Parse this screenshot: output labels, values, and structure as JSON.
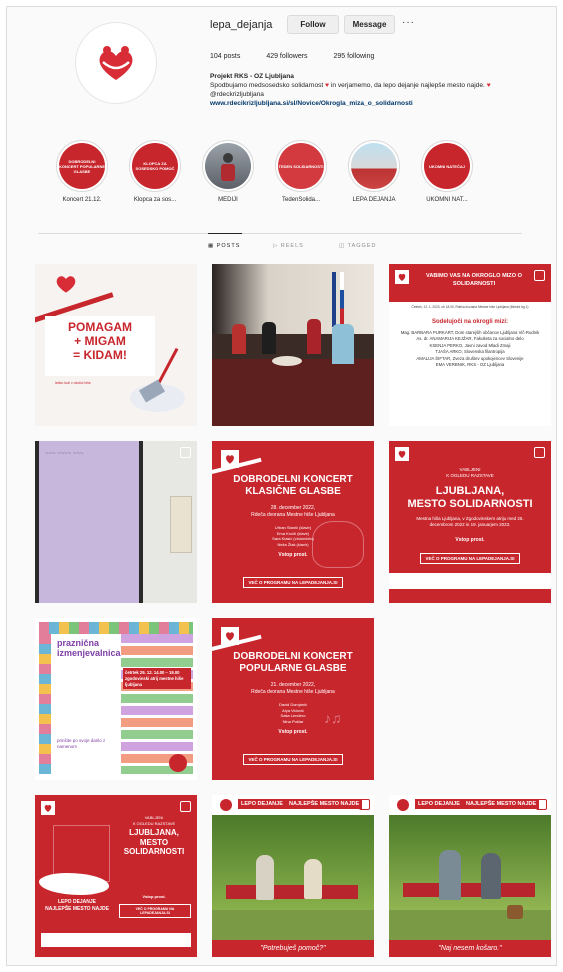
{
  "profile": {
    "username": "lepa_dejanja",
    "follow_label": "Follow",
    "message_label": "Message",
    "more_label": "···",
    "stats": {
      "posts": "104 posts",
      "followers": "429 followers",
      "following": "295 following"
    },
    "bio_name": "Projekt RKS - OZ Ljubljana",
    "bio_line1": "Spodbujamo medsosedsko solidarnost",
    "bio_line1b": "in verjamemo, da lepo dejanje najlepše mesto",
    "bio_line2a": "najde.",
    "bio_line2b": "@rdeckrizljubljana",
    "bio_link": "www.rdecikrizljubljana.si/sl/Novice/Okrogla_miza_o_solidarnosti"
  },
  "highlights": [
    {
      "label": "Koncert 21.12.",
      "inner": "DOBRODELNI KONCERT POPULARNE GLASBE",
      "color": "#c8262d"
    },
    {
      "label": "Klopca za sos...",
      "inner": "KLOPCA ZA SOSEDSKO POMOČ",
      "color": "#c8262d"
    },
    {
      "label": "MEDIJI",
      "inner": "",
      "color": "#7a7f86"
    },
    {
      "label": "TedenSolida...",
      "inner": "TEDEN SOLIDARNOSTI",
      "color": "#d23a40"
    },
    {
      "label": "LEPA DEJANJA",
      "inner": "",
      "color": "#cfd6dc"
    },
    {
      "label": "UKOMNI NAT...",
      "inner": "UKOMNI NATEČAJ",
      "color": "#c8262d"
    }
  ],
  "tabs": {
    "posts": "POSTS",
    "reels": "REELS",
    "tagged": "TAGGED"
  },
  "posts": {
    "p1": {
      "line1": "POMAGAM",
      "line2": "+ MIGAM",
      "line3": "= KIDAM!",
      "small": "lahko tudi v okolici hiše"
    },
    "p3": {
      "title": "VABIMO VAS NA OKROGLO MIZO O SOLIDARNOSTI",
      "date": "Četrtek, 12. 1. 2023, ob 18.00, Rdeča dvorana Mestne hiše Ljubljana (Mestni trg 1)",
      "heading": "Sodelujoči na okrogli mizi:",
      "people": [
        "Mag. BARBARA PURKART, Dom starejših občanov Ljubljana Vič-Rudnik",
        "As. dr. ANAMARIJA KEJŽAR, Fakulteta za socialno delo",
        "KSENJA PERKO, Javni zavod Mladi Zmaji",
        "TJAŠA ARKO, Slovenska filantropija",
        "AMALIJA ŠIFTAR, Zveza društev upokojencev Slovenije",
        "EMA VERBNIK, RKS - OZ Ljubljana"
      ]
    },
    "p5": {
      "title1": "DOBRODELNI KONCERT",
      "title2": "KLASIČNE GLASBE",
      "date": "28. december 2022,",
      "place": "Rdeča dvorana Mestne hiše Ljubljana",
      "performers": [
        "Urban Stanič (klavir)",
        "Ema Kročil (klavir)",
        "Sara Klasić (violončelo)",
        "Neža Žlak (klavir)"
      ],
      "entry": "Vstop prost.",
      "btn": "VEČ O PROGRAMU NA LEPADEJANJA.SI"
    },
    "p6": {
      "small1": "VABLJENI",
      "small2": "K OGLEDU RAZSTAVE",
      "title1": "LJUBLJANA,",
      "title2": "MESTO SOLIDARNOSTI",
      "info": "Mestna hiša Ljubljana, v Zgodovinskem atriju med 25. decembrom 2022 in 19. januarjem 2023.",
      "entry": "Vstop prost.",
      "btn": "VEČ O PROGRAMU NA LEPADEJANJA.SI"
    },
    "p7": {
      "title1": "praznična",
      "title2": "izmenjevalnica",
      "info": "četrtek 29. 12. 14.00 – 19.00 zgodovinski atrij mestne hiše ljubljana",
      "foot": "prinšite po svoje darilo z namenom"
    },
    "p8": {
      "title1": "DOBRODELNI KONCERT",
      "title2": "POPULARNE GLASBE",
      "date": "21. december 2022,",
      "place": "Rdeča dvorana Mestne hiše Ljubljana",
      "performers": [
        "David Domjanić",
        "Alya Vidović",
        "Saša Lendero",
        "Nina Pušlar"
      ],
      "entry": "Vstop prost.",
      "btn": "VEČ O PROGRAMU NA LEPADEJANJA.SI"
    },
    "p10": {
      "small1": "VABLJENI",
      "small2": "K OGLEDU RAZSTAVE",
      "title1": "LJUBLJANA,",
      "title2": "MESTO",
      "title3": "SOLIDARNOSTI",
      "brand1": "LEPO DEJANJE",
      "brand2": "NAJLEPŠE MESTO NAJDE",
      "btn": "VEČ O PROGRAMU NA LEPADEJANJA.SI",
      "entry": "Vstop prost."
    },
    "p11": {
      "banner1": "LEPO DEJANJE",
      "banner2": "NAJLEPŠE MESTO NAJDE",
      "caption": "\"Potrebuješ pomoč?\""
    },
    "p12": {
      "banner1": "LEPO DEJANJE",
      "banner2": "NAJLEPŠE MESTO NAJDE",
      "caption": "\"Naj nesem košaro.\""
    }
  },
  "colors": {
    "brand_red": "#c8262d",
    "link": "#00376b"
  }
}
